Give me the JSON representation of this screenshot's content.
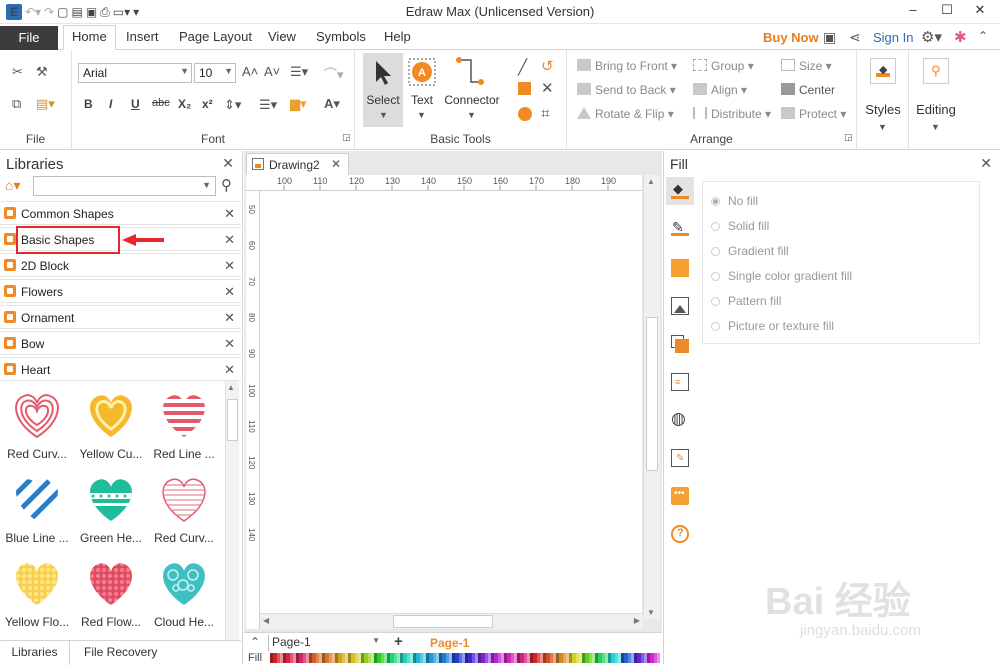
{
  "window": {
    "title": "Edraw Max (Unlicensed Version)"
  },
  "quick_access": {
    "icons": [
      "undo-icon",
      "redo-icon",
      "new-icon",
      "open-icon",
      "save-icon",
      "print-icon",
      "export-icon",
      "customize-icon"
    ]
  },
  "menu": {
    "file": "File",
    "tabs": [
      "Home",
      "Insert",
      "Page Layout",
      "View",
      "Symbols",
      "Help"
    ],
    "active_tab": "Home",
    "buy_now": "Buy Now",
    "sign_in": "Sign In"
  },
  "ribbon": {
    "file_group": {
      "label": "File"
    },
    "font_group": {
      "label": "Font",
      "font_name": "Arial",
      "font_size": "10",
      "bold": "B",
      "italic": "I",
      "underline": "U",
      "strike": "abc",
      "sub": "X₂",
      "sup": "x²"
    },
    "basic_tools": {
      "label": "Basic Tools",
      "select": "Select",
      "text": "Text",
      "connector": "Connector"
    },
    "arrange": {
      "label": "Arrange",
      "bring_to_front": "Bring to Front",
      "send_to_back": "Send to Back",
      "rotate_flip": "Rotate & Flip",
      "group": "Group",
      "align": "Align",
      "distribute": "Distribute",
      "size": "Size",
      "center": "Center",
      "protect": "Protect"
    },
    "styles": "Styles",
    "editing": "Editing"
  },
  "libraries": {
    "title": "Libraries",
    "categories": [
      "Common Shapes",
      "Basic Shapes",
      "2D Block",
      "Flowers",
      "Ornament",
      "Bow",
      "Heart"
    ],
    "highlighted": "Basic Shapes",
    "shapes": [
      {
        "label": "Red Curv..."
      },
      {
        "label": "Yellow Cu..."
      },
      {
        "label": "Red Line ..."
      },
      {
        "label": "Blue Line ..."
      },
      {
        "label": "Green He..."
      },
      {
        "label": "Red Curv..."
      },
      {
        "label": "Yellow Flo..."
      },
      {
        "label": "Red Flow..."
      },
      {
        "label": "Cloud He..."
      }
    ],
    "bottom_tabs": [
      "Libraries",
      "File Recovery"
    ]
  },
  "document": {
    "tab": "Drawing2",
    "ruler_h": [
      "100",
      "110",
      "120",
      "130",
      "140",
      "150",
      "160",
      "170",
      "180",
      "190"
    ],
    "ruler_v": [
      "50",
      "60",
      "70",
      "80",
      "90",
      "100",
      "110",
      "120",
      "130",
      "140"
    ],
    "page_selector": "Page-1",
    "active_page": "Page-1",
    "fill_label": "Fill"
  },
  "fill_panel": {
    "title": "Fill",
    "options": [
      "No fill",
      "Solid fill",
      "Gradient fill",
      "Single color gradient fill",
      "Pattern fill",
      "Picture or texture fill"
    ],
    "selected": "No fill"
  },
  "colors": {
    "accent": "#f08a24",
    "brand_blue": "#2c6cb0",
    "highlight_red": "#e8262b"
  },
  "watermark": {
    "main": "Bai 经验",
    "sub": "jingyan.baidu.com"
  }
}
